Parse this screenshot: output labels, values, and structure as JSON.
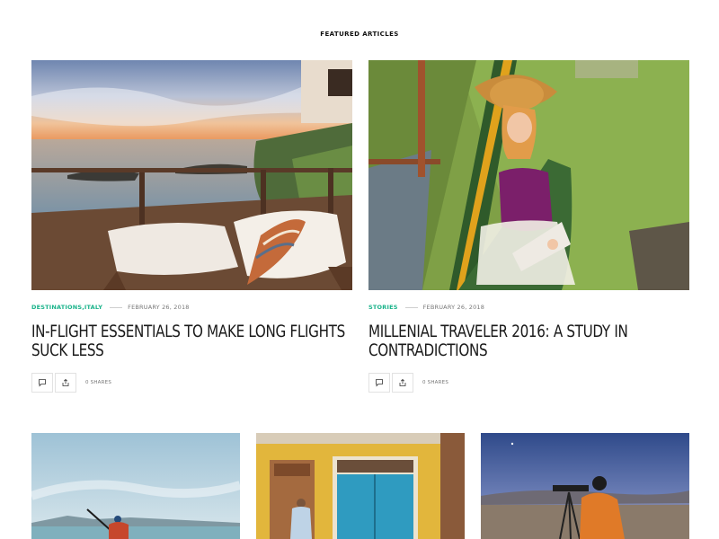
{
  "section": {
    "title": "FEATURED ARTICLES"
  },
  "articles": [
    {
      "category": "DESTINATIONS,ITALY",
      "date": "FEBRUARY 26, 2018",
      "title": "IN-FLIGHT ESSENTIALS TO MAKE LONG FLIGHTS SUCK LESS",
      "shares": "0 SHARES"
    },
    {
      "category": "STORIES",
      "date": "FEBRUARY 26, 2018",
      "title": "MILLENIAL TRAVELER 2016: A STUDY IN CONTRADICTIONS",
      "shares": "0 SHARES"
    }
  ],
  "colors": {
    "category": "#1ab38a",
    "text": "#1a1a1a",
    "meta": "#777777"
  },
  "icons": {
    "comment": "comment-icon",
    "share": "share-icon"
  }
}
